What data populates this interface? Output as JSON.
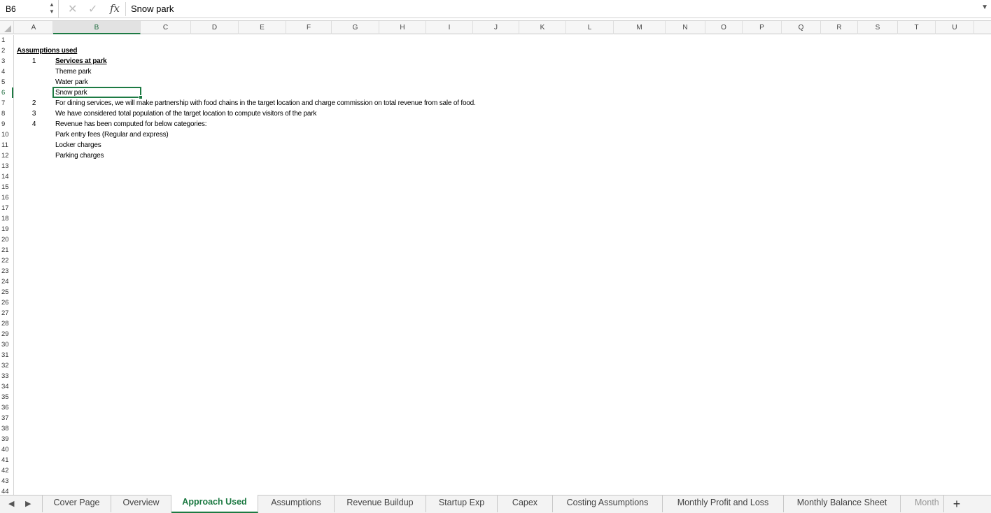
{
  "formula_bar": {
    "name_box": "B6",
    "formula_value": "Snow park",
    "fx_label": "fx",
    "cancel_icon": "close-icon",
    "confirm_icon": "check-icon"
  },
  "columns": [
    "A",
    "B",
    "C",
    "D",
    "E",
    "F",
    "G",
    "H",
    "I",
    "J",
    "K",
    "L",
    "M",
    "N",
    "O",
    "P",
    "Q",
    "R",
    "S",
    "T",
    "U"
  ],
  "selected_column": "B",
  "selected_row": "6",
  "rows": [
    "1",
    "2",
    "3",
    "4",
    "5",
    "6",
    "7",
    "8",
    "9",
    "10",
    "11",
    "12",
    "13",
    "14",
    "15",
    "16",
    "17",
    "18",
    "19",
    "20",
    "21",
    "22",
    "23",
    "24",
    "25",
    "26",
    "27",
    "28",
    "29",
    "30",
    "31",
    "32",
    "33",
    "34",
    "35",
    "36",
    "37",
    "38",
    "39",
    "40",
    "41",
    "42",
    "43",
    "44"
  ],
  "cells": {
    "title": "Assumptions used ",
    "n1": "1",
    "services_heading": "Services at park",
    "theme_park": "Theme park",
    "water_park": "Water park",
    "snow_park": "Snow park",
    "n2": "2",
    "dining": "For dining services, we will make partnership with food chains in the target location and charge commission on total revenue from sale of food.",
    "n3": "3",
    "population": "We have considered total population of the target location to compute visitors  of the park",
    "n4": "4",
    "revenue": "Revenue has been computed for  below categories:",
    "entry_fees": "Park entry fees (Regular and express)",
    "locker": "Locker charges",
    "parking": "Parking charges"
  },
  "sheet_tabs": {
    "cover_page": "Cover Page",
    "overview": "Overview",
    "approach_used": "Approach Used",
    "assumptions": "Assumptions",
    "revenue_buildup": "Revenue Buildup",
    "startup_exp": "Startup Exp",
    "capex": "Capex",
    "costing_assumptions": "Costing Assumptions",
    "monthly_pl": "Monthly Profit and Loss",
    "monthly_bs": "Monthly Balance Sheet",
    "month_cut": "Month",
    "add_sheet": "+"
  },
  "active_tab": "Approach Used",
  "accent_color": "#1d7a43"
}
